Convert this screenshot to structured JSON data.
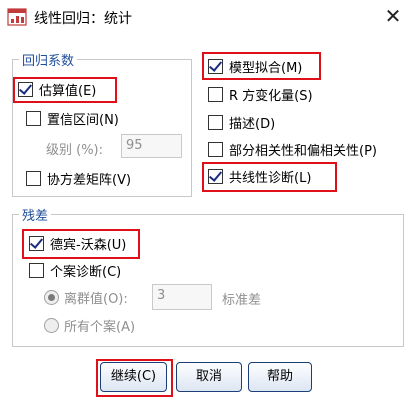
{
  "window": {
    "title": "线性回归：统计"
  },
  "regression_coefficients": {
    "legend": "回归系数",
    "estimates": {
      "label": "估算值(E)",
      "checked": true
    },
    "confidence_intervals": {
      "label": "置信区间(N)",
      "checked": false
    },
    "level_label": "级别 (%):",
    "level_value": "95",
    "covariance_matrix": {
      "label": "协方差矩阵(V)",
      "checked": false
    }
  },
  "right_options": {
    "model_fit": {
      "label": "模型拟合(M)",
      "checked": true
    },
    "r_squared_change": {
      "label": "R 方变化量(S)",
      "checked": false
    },
    "descriptives": {
      "label": "描述(D)",
      "checked": false
    },
    "part_partial_correlations": {
      "label": "部分相关性和偏相关性(P)",
      "checked": false
    },
    "collinearity_diagnostics": {
      "label": "共线性诊断(L)",
      "checked": true
    }
  },
  "residuals": {
    "legend": "残差",
    "durbin_watson": {
      "label": "德宾-沃森(U)",
      "checked": true
    },
    "casewise_diagnostics": {
      "label": "个案诊断(C)",
      "checked": false
    },
    "outliers_outside": {
      "label": "离群值(O):",
      "selected": true
    },
    "outliers_value": "3",
    "std_dev_label": "标准差",
    "all_cases": {
      "label": "所有个案(A)",
      "selected": false
    }
  },
  "buttons": {
    "continue": "继续(C)",
    "cancel": "取消",
    "help": "帮助"
  },
  "colors": {
    "highlight": "#e0101b",
    "legend_text": "#1f4e9c",
    "button_border": "#1c3f78"
  }
}
